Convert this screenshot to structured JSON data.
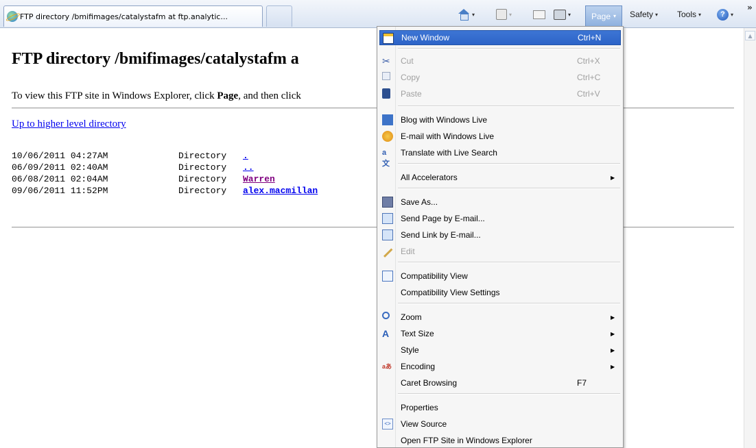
{
  "browser": {
    "tab_title": "FTP directory /bmifimages/catalystafm at ftp.analytic...",
    "toolbar": {
      "page_label": "Page",
      "safety_label": "Safety",
      "tools_label": "Tools",
      "overflow_label": "»",
      "caret": "▾"
    }
  },
  "page": {
    "title": "FTP directory /bmifimages/catalystafm a",
    "instructions_pre": "To view this FTP site in Windows Explorer, click ",
    "instructions_bold": "Page",
    "instructions_post": ", and then click",
    "up_link": "Up to higher level directory",
    "entries": [
      {
        "date": "10/06/2011 04:27AM",
        "type": "Directory",
        "name": ".",
        "visited": false
      },
      {
        "date": "06/09/2011 02:40AM",
        "type": "Directory",
        "name": "..",
        "visited": false
      },
      {
        "date": "06/08/2011 02:04AM",
        "type": "Directory",
        "name": "Warren",
        "visited": true
      },
      {
        "date": "09/06/2011 11:52PM",
        "type": "Directory",
        "name": "alex.macmillan",
        "visited": false
      }
    ]
  },
  "menu": {
    "new_window": {
      "label": "New Window",
      "shortcut": "Ctrl+N"
    },
    "cut": {
      "label": "Cut",
      "shortcut": "Ctrl+X"
    },
    "copy": {
      "label": "Copy",
      "shortcut": "Ctrl+C"
    },
    "paste": {
      "label": "Paste",
      "shortcut": "Ctrl+V"
    },
    "blog": {
      "label": "Blog with Windows Live"
    },
    "email_live": {
      "label": "E-mail with Windows Live"
    },
    "translate": {
      "label": "Translate with Live Search"
    },
    "all_accelerators": {
      "label": "All Accelerators"
    },
    "save_as": {
      "label": "Save As..."
    },
    "send_page": {
      "label": "Send Page by E-mail..."
    },
    "send_link": {
      "label": "Send Link by E-mail..."
    },
    "edit": {
      "label": "Edit"
    },
    "compat_view": {
      "label": "Compatibility View"
    },
    "compat_settings": {
      "label": "Compatibility View Settings"
    },
    "zoom": {
      "label": "Zoom"
    },
    "text_size": {
      "label": "Text Size"
    },
    "style": {
      "label": "Style"
    },
    "encoding": {
      "label": "Encoding"
    },
    "caret_browsing": {
      "label": "Caret Browsing",
      "shortcut": "F7"
    },
    "properties": {
      "label": "Properties"
    },
    "view_source": {
      "label": "View Source"
    },
    "open_ftp": {
      "label": "Open FTP Site in Windows Explorer"
    },
    "submenu_arrow": "▶"
  }
}
